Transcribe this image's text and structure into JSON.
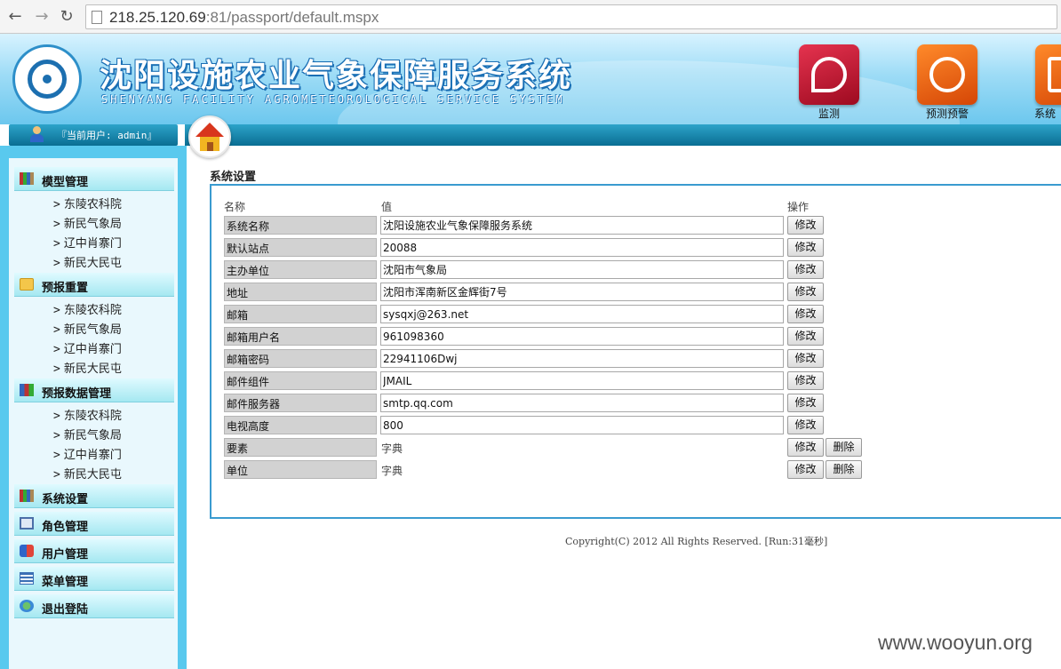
{
  "browser": {
    "url_host": "218.25.120.69",
    "url_rest": ":81/passport/default.mspx"
  },
  "header": {
    "title": "沈阳设施农业气象保障服务系统",
    "subtitle": "SHENYANG FACILITY AGROMETEOROLOGICAL SERVICE SYSTEM",
    "nav": [
      {
        "label": "监测",
        "icon": "satellite-dish-icon",
        "color": "#c4112d"
      },
      {
        "label": "预测预警",
        "icon": "globe-icon",
        "color": "#ec5a0b"
      },
      {
        "label": "系统",
        "icon": "chip-icon",
        "color": "#e0600e"
      }
    ]
  },
  "user": {
    "text": "『当前用户: admin』"
  },
  "sidebar": {
    "groups": [
      {
        "label": "模型管理",
        "icon": "books-icon",
        "items": [
          "东陵农科院",
          "新民气象局",
          "辽中肖寨门",
          "新民大民屯"
        ]
      },
      {
        "label": "预报重置",
        "icon": "folder-icon",
        "items": [
          "东陵农科院",
          "新民气象局",
          "辽中肖寨门",
          "新民大民屯"
        ]
      },
      {
        "label": "预报数据管理",
        "icon": "books-icon",
        "items": [
          "东陵农科院",
          "新民气象局",
          "辽中肖寨门",
          "新民大民屯"
        ]
      }
    ],
    "single": [
      {
        "label": "系统设置",
        "icon": "books-icon"
      },
      {
        "label": "角色管理",
        "icon": "portrait-icon"
      },
      {
        "label": "用户管理",
        "icon": "user-book-icon"
      },
      {
        "label": "菜单管理",
        "icon": "list-icon"
      },
      {
        "label": "退出登陆",
        "icon": "globe-exit-icon"
      }
    ],
    "arrow": ">"
  },
  "main": {
    "title": "系统设置",
    "columns": {
      "name": "名称",
      "value": "值",
      "action": "操作"
    },
    "edit_label": "修改",
    "delete_label": "删除",
    "rows": [
      {
        "name": "系统名称",
        "value": "沈阳设施农业气象保障服务系统"
      },
      {
        "name": "默认站点",
        "value": "20088"
      },
      {
        "name": "主办单位",
        "value": "沈阳市气象局"
      },
      {
        "name": "地址",
        "value": "沈阳市浑南新区金辉街7号"
      },
      {
        "name": "邮箱",
        "value": "sysqxj@263.net"
      },
      {
        "name": "邮箱用户名",
        "value": "961098360"
      },
      {
        "name": "邮箱密码",
        "value": "22941106Dwj"
      },
      {
        "name": "邮件组件",
        "value": "JMAIL"
      },
      {
        "name": "邮件服务器",
        "value": "smtp.qq.com"
      },
      {
        "name": "电视高度",
        "value": "800"
      }
    ],
    "dict_rows": [
      {
        "name": "要素",
        "value": "字典"
      },
      {
        "name": "单位",
        "value": "字典"
      }
    ]
  },
  "footer": "Copyright(C) 2012 All Rights Reserved. [Run:31毫秒]",
  "watermark": "www.wooyun.org"
}
